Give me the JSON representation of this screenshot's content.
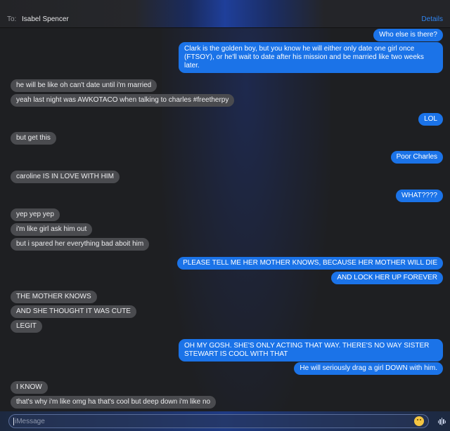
{
  "header": {
    "to_label": "To:",
    "recipient": "Isabel Spencer",
    "details_label": "Details"
  },
  "messages": [
    {
      "from": "me",
      "text": "Who else is there?"
    },
    {
      "from": "me",
      "text": "Clark is the golden boy, but you know he will either only date one girl once (FTSOY), or he'll wait to date after his mission and be married like two weeks later."
    },
    {
      "from": "them",
      "text": "he will be like oh can't date until i'm married"
    },
    {
      "from": "them",
      "text": "yeah last night was AWKOTACO when talking to charles #freetherpy"
    },
    {
      "from": "me",
      "text": "LOL"
    },
    {
      "from": "them",
      "text": "but get this"
    },
    {
      "from": "me",
      "text": "Poor Charles"
    },
    {
      "from": "them",
      "text": "caroline IS IN LOVE WITH HIM"
    },
    {
      "from": "me",
      "text": "WHAT????"
    },
    {
      "from": "them",
      "text": "yep yep yep"
    },
    {
      "from": "them",
      "text": "i'm like girl ask him out"
    },
    {
      "from": "them",
      "text": "but i spared her everything bad aboit him"
    },
    {
      "from": "me",
      "text": "PLEASE TELL ME HER MOTHER KNOWS, BECAUSE HER MOTHER WILL DIE"
    },
    {
      "from": "me",
      "text": "AND LOCK HER UP FOREVER"
    },
    {
      "from": "them",
      "text": "THE MOTHER KNOWS"
    },
    {
      "from": "them",
      "text": "AND SHE THOUGHT IT WAS CUTE"
    },
    {
      "from": "them",
      "text": "LEGIT"
    },
    {
      "from": "me",
      "text": "OH MY GOSH.  SHE'S ONLY ACTING THAT WAY.  THERE'S NO WAY SISTER STEWART IS COOL WITH THAT"
    },
    {
      "from": "me",
      "text": "He will seriously drag a girl DOWN with him."
    },
    {
      "from": "them",
      "text": "I KNOW"
    },
    {
      "from": "them",
      "text": "that's why i'm like omg ha that's cool but deep down i'm like no"
    }
  ],
  "composer": {
    "placeholder": "iMessage",
    "emoji_icon": "emoji-icon",
    "audio_icon": "audio-waveform-icon"
  },
  "colors": {
    "outgoing_bubble": "#1b73e8",
    "incoming_bubble": "#4a4b4f",
    "details_link": "#2f84f0",
    "background": "#1e1f22"
  }
}
